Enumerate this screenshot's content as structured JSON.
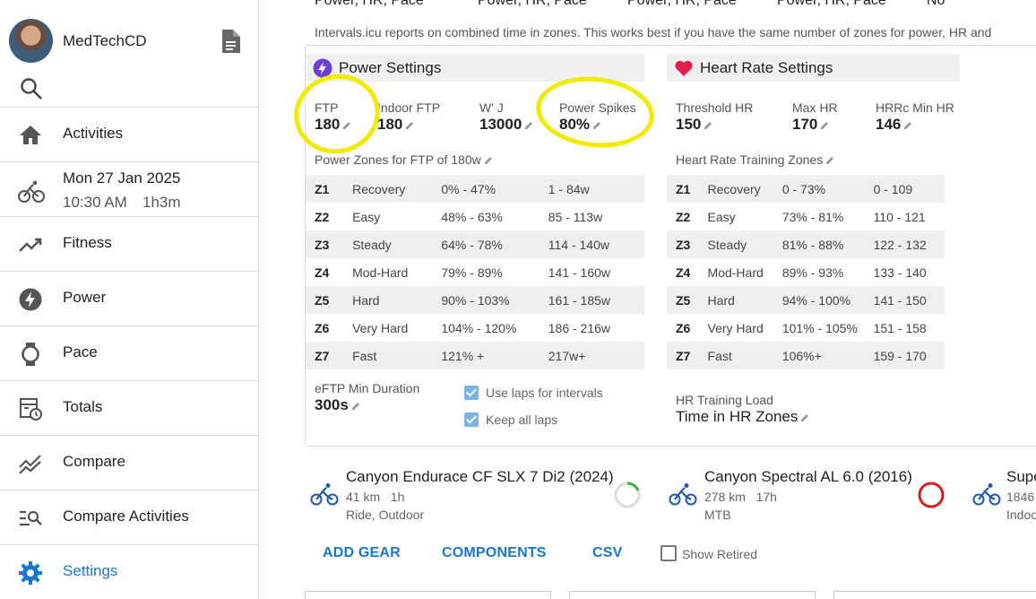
{
  "sidebar": {
    "user_name": "MedTechCD",
    "activity": {
      "date": "Mon 27 Jan 2025",
      "time": "10:30 AM",
      "duration": "1h3m"
    },
    "items": [
      {
        "label": "Activities",
        "icon": "home-icon"
      },
      {
        "label": "Fitness",
        "icon": "trending-up-icon"
      },
      {
        "label": "Power",
        "icon": "bolt-icon"
      },
      {
        "label": "Pace",
        "icon": "watch-icon"
      },
      {
        "label": "Totals",
        "icon": "calendar-clock-icon"
      },
      {
        "label": "Compare",
        "icon": "multiline-chart-icon"
      },
      {
        "label": "Compare Activities",
        "icon": "manage-search-icon"
      },
      {
        "label": "Settings",
        "icon": "gear-icon",
        "active": true
      }
    ]
  },
  "top_cut": [
    "Power, HR, Pace",
    "Power, HR, Pace",
    "Power, HR, Pace",
    "Power, HR, Pace",
    "No"
  ],
  "note": "Intervals.icu reports on combined time in zones. This works best if you have the same number of zones for power, HR and",
  "power": {
    "title": "Power Settings",
    "fields": [
      {
        "label": "FTP",
        "value": "180"
      },
      {
        "label": "Indoor FTP",
        "value": "180"
      },
      {
        "label": "W' J",
        "value": "13000"
      },
      {
        "label": "Power Spikes",
        "value": "80%"
      }
    ],
    "zones_label": "Power Zones for FTP of 180w",
    "zones": [
      [
        "Z1",
        "Recovery",
        "0% - 47%",
        "1 - 84w"
      ],
      [
        "Z2",
        "Easy",
        "48% - 63%",
        "85 - 113w"
      ],
      [
        "Z3",
        "Steady",
        "64% - 78%",
        "114 - 140w"
      ],
      [
        "Z4",
        "Mod-Hard",
        "79% - 89%",
        "141 - 160w"
      ],
      [
        "Z5",
        "Hard",
        "90% - 103%",
        "161 - 185w"
      ],
      [
        "Z6",
        "Very Hard",
        "104% - 120%",
        "186 - 216w"
      ],
      [
        "Z7",
        "Fast",
        "121% +",
        "217w+"
      ]
    ],
    "eftp_label": "eFTP Min Duration",
    "eftp_value": "300s",
    "use_laps": "Use laps for intervals",
    "keep_laps": "Keep all laps"
  },
  "hr": {
    "title": "Heart Rate Settings",
    "fields": [
      {
        "label": "Threshold HR",
        "value": "150"
      },
      {
        "label": "Max HR",
        "value": "170"
      },
      {
        "label": "HRRc Min HR",
        "value": "146"
      }
    ],
    "zones_label": "Heart Rate Training Zones",
    "zones": [
      [
        "Z1",
        "Recovery",
        "0 - 73%",
        "0 - 109"
      ],
      [
        "Z2",
        "Easy",
        "73% - 81%",
        "110 - 121"
      ],
      [
        "Z3",
        "Steady",
        "81% - 88%",
        "122 - 132"
      ],
      [
        "Z4",
        "Mod-Hard",
        "89% - 93%",
        "133 - 140"
      ],
      [
        "Z5",
        "Hard",
        "94% - 100%",
        "141 - 150"
      ],
      [
        "Z6",
        "Very Hard",
        "101% - 105%",
        "151 - 158"
      ],
      [
        "Z7",
        "Fast",
        "106%+",
        "159 - 170"
      ]
    ],
    "load_label": "HR Training Load",
    "load_value": "Time in HR Zones"
  },
  "gear": [
    {
      "name": "Canyon Endurace CF SLX 7 Di2 (2024)",
      "distance": "41 km",
      "time": "1h",
      "type": "Ride, Outdoor"
    },
    {
      "name": "Canyon Spectral AL 6.0 (2016)",
      "distance": "278 km",
      "time": "17h",
      "type": "MTB"
    },
    {
      "name": "Supe",
      "distance": "1846",
      "time": "",
      "type": "Indoo"
    }
  ],
  "actions": {
    "add_gear": "ADD GEAR",
    "components": "COMPONENTS",
    "csv": "CSV",
    "show_retired": "Show Retired"
  },
  "colors": {
    "accent": "#1976d2",
    "power_icon": "#6c3fd6",
    "heart": "#e0204a",
    "highlight": "#f2ea00"
  }
}
